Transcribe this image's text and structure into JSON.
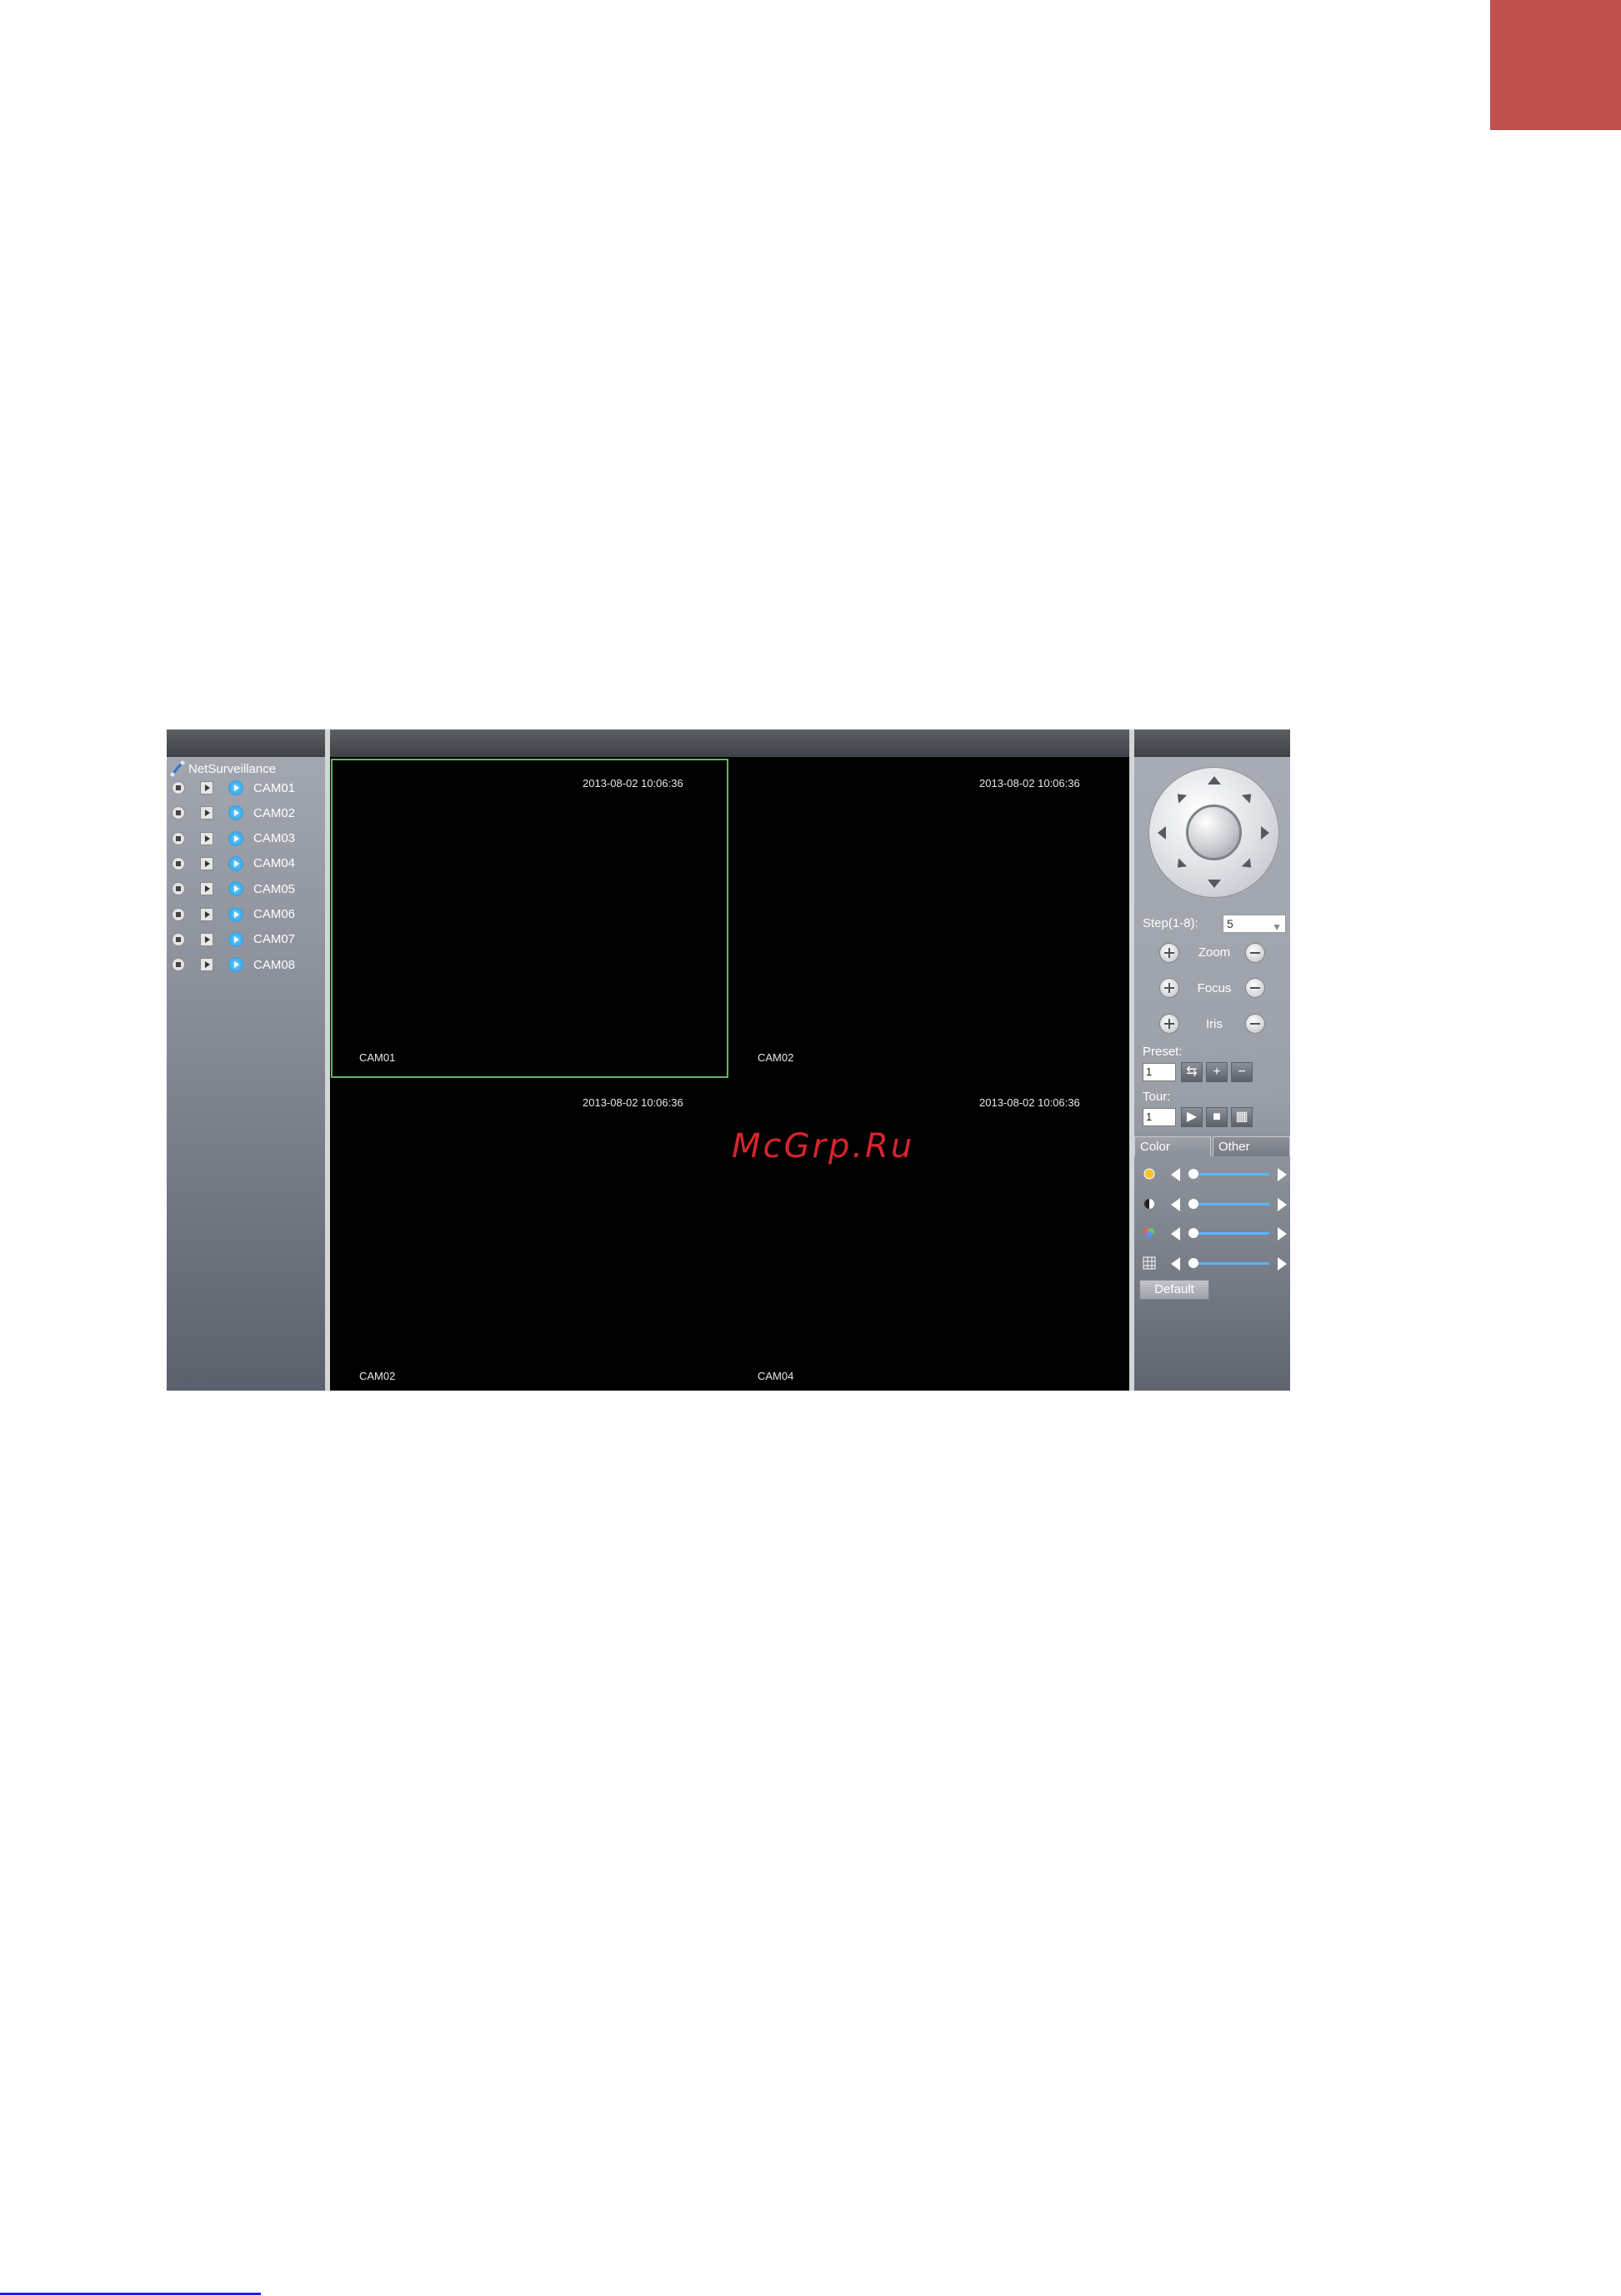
{
  "page": {
    "watermark": "McGrp.Ru",
    "accent_color": "#c0504d"
  },
  "app": {
    "tree": {
      "root_label": "NetSurveillance",
      "cameras": [
        "CAM01",
        "CAM02",
        "CAM03",
        "CAM04",
        "CAM05",
        "CAM06",
        "CAM07",
        "CAM08"
      ]
    },
    "video": {
      "tiles": [
        {
          "timestamp": "2013-08-02 10:06:36",
          "camera": "CAM01"
        },
        {
          "timestamp": "2013-08-02 10:06:36",
          "camera": "CAM02"
        },
        {
          "timestamp": "2013-08-02 10:06:36",
          "camera": "CAM02"
        },
        {
          "timestamp": "2013-08-02 10:06:36",
          "camera": "CAM04"
        }
      ]
    },
    "ptz": {
      "step_label": "Step(1-8):",
      "step_value": "5",
      "zoom_label": "Zoom",
      "focus_label": "Focus",
      "iris_label": "Iris",
      "preset_label": "Preset:",
      "preset_value": "1",
      "tour_label": "Tour:",
      "tour_value": "1"
    },
    "image_tabs": {
      "color_label": "Color",
      "other_label": "Other"
    },
    "default_label": "Default"
  }
}
